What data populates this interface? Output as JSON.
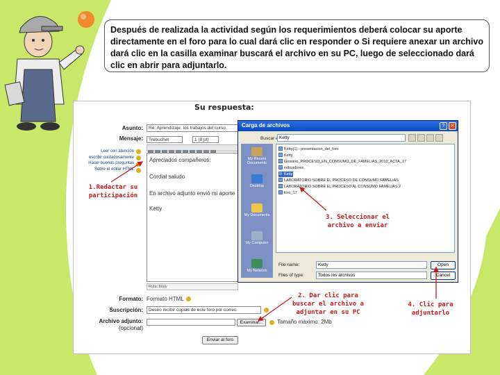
{
  "instructions": "Después de realizada la actividad según los requerimientos deberá colocar su aporte directamente en el foro para lo cual dará clic en responder o Si requiere anexar un archivo dará clic en la casilla examinar buscará el archivo en su PC, luego de seleccionado dará clic en abrir para adjuntarlo.",
  "form": {
    "title": "Su respuesta:",
    "subject_label": "Asunto:",
    "subject_value": "Re: Aprendizaje: los trabajos del curso",
    "message_label": "Mensaje:",
    "font_select": "Trebuchet",
    "size_select": "1 (8 pt)",
    "help_links": [
      "Leer con atención",
      "escribir cuidadosamente",
      "Hacer buenas preguntas",
      "Sobre el editor HTML"
    ],
    "editor_lines": [
      "Apreciados compañeros:",
      "Cordial saludo",
      "En archivo adjunto envió mi aporte",
      "Ketty"
    ],
    "path_label": "Ruta: body",
    "format_label": "Formato:",
    "format_value": "Formato HTML",
    "subscription_label": "Suscripción:",
    "subscription_value": "Deseo recibir copias de este foro por correo",
    "attachment_label": "Archivo adjunto:",
    "attachment_optional": "(opcional)",
    "browse_button": "Examinar...",
    "max_size": "Tamaño máximo: 2Mb",
    "submit_button": "Enviar al foro"
  },
  "dialog": {
    "title": "Carga de archivos",
    "lookin_label": "Buscar en:",
    "lookin_value": "Ketty",
    "places": [
      "My Recent Documents",
      "Desktop",
      "My Documents",
      "My Computer",
      "My Network"
    ],
    "files": [
      "Ketty(1) - presentacion_del_foro",
      "Ketty",
      "Glosario_PROCESO_EN_CONSUMO_DE_FAMELIAS_2010_ACTA_17",
      "indicadores",
      "Ketty",
      "LABORATORIO SOBRE EL PROCESO DE CONSUMO FAMELIAS",
      "LABORATORIO SOBRE EL PROCESO AL CONSUMO FAMELIAS 2",
      "foro_17"
    ],
    "selected_index": 4,
    "filename_label": "File name:",
    "filename_value": "Ketty",
    "filetype_label": "Files of type:",
    "filetype_value": "Todos los archivos",
    "open_button": "Open",
    "cancel_button": "Cancel",
    "help_glyph": "?",
    "close_glyph": "✕"
  },
  "annotations": {
    "step1": [
      "1.Redactar su",
      "participación"
    ],
    "step2": [
      "2. Dar clic para",
      "buscar el archivo a",
      "adjuntar en su PC"
    ],
    "step3": [
      "3. Seleccionar el",
      "archivo a enviar"
    ],
    "step4": [
      "4. Clic para",
      "adjuntarlo"
    ]
  },
  "colors": {
    "slide_green": "#c9e86a",
    "annotation_red": "#c8191e",
    "dialog_title_blue": "#0a4bc4",
    "selection_blue": "#316ac5"
  }
}
